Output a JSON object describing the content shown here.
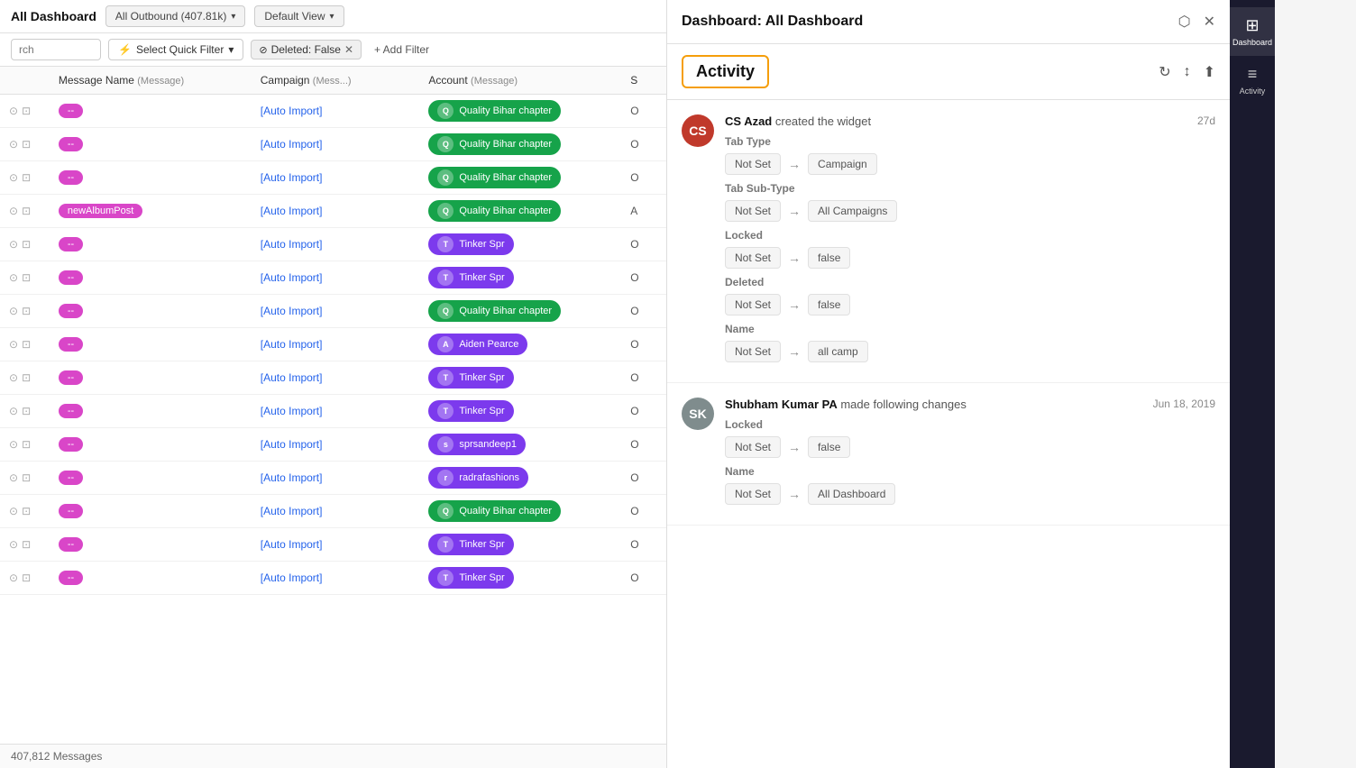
{
  "topBar": {
    "title": "All Dashboard",
    "filterLabel": "All Outbound (407.81k)",
    "viewLabel": "Default View"
  },
  "filterBar": {
    "searchPlaceholder": "rch",
    "quickFilterLabel": "Select Quick Filter",
    "deletedFilterLabel": "Deleted: False",
    "addFilterLabel": "+ Add Filter"
  },
  "table": {
    "columns": [
      {
        "name": "Message Name",
        "type": "Message"
      },
      {
        "name": "Campaign",
        "type": "Mess..."
      },
      {
        "name": "Account",
        "type": "Message"
      },
      {
        "name": "S",
        "type": ""
      }
    ],
    "rows": [
      {
        "tag": "--",
        "tagColor": "pink",
        "campaign": "[Auto Import]",
        "account": "Quality Bihar chapter",
        "accountColor": "green",
        "status": "O"
      },
      {
        "tag": "--",
        "tagColor": "pink",
        "campaign": "[Auto Import]",
        "account": "Quality Bihar chapter",
        "accountColor": "green",
        "status": "O"
      },
      {
        "tag": "--",
        "tagColor": "pink",
        "campaign": "[Auto Import]",
        "account": "Quality Bihar chapter",
        "accountColor": "green",
        "status": "O"
      },
      {
        "tag": "newAlbumPost",
        "tagColor": "pink",
        "campaign": "[Auto Import]",
        "account": "Quality Bihar chapter",
        "accountColor": "green",
        "status": "A"
      },
      {
        "tag": "--",
        "tagColor": "pink",
        "campaign": "[Auto Import]",
        "account": "Tinker Spr",
        "accountColor": "purple",
        "status": "O"
      },
      {
        "tag": "--",
        "tagColor": "pink",
        "campaign": "[Auto Import]",
        "account": "Tinker Spr",
        "accountColor": "purple",
        "status": "O"
      },
      {
        "tag": "--",
        "tagColor": "pink",
        "campaign": "[Auto Import]",
        "account": "Quality Bihar chapter",
        "accountColor": "green",
        "status": "O"
      },
      {
        "tag": "--",
        "tagColor": "pink",
        "campaign": "[Auto Import]",
        "account": "Aiden Pearce",
        "accountColor": "purple",
        "status": "O"
      },
      {
        "tag": "--",
        "tagColor": "pink",
        "campaign": "[Auto Import]",
        "account": "Tinker Spr",
        "accountColor": "purple",
        "status": "O"
      },
      {
        "tag": "--",
        "tagColor": "pink",
        "campaign": "[Auto Import]",
        "account": "Tinker Spr",
        "accountColor": "purple",
        "status": "O"
      },
      {
        "tag": "--",
        "tagColor": "pink",
        "campaign": "[Auto Import]",
        "account": "sprsandeep1",
        "accountColor": "purple",
        "status": "O"
      },
      {
        "tag": "--",
        "tagColor": "pink",
        "campaign": "[Auto Import]",
        "account": "radrafashions",
        "accountColor": "purple",
        "status": "O"
      },
      {
        "tag": "--",
        "tagColor": "pink",
        "campaign": "[Auto Import]",
        "account": "Quality Bihar chapter",
        "accountColor": "green",
        "status": "O"
      },
      {
        "tag": "--",
        "tagColor": "pink",
        "campaign": "[Auto Import]",
        "account": "Tinker Spr",
        "accountColor": "purple",
        "status": "O"
      },
      {
        "tag": "--",
        "tagColor": "pink",
        "campaign": "[Auto Import]",
        "account": "Tinker Spr",
        "accountColor": "purple",
        "status": "O"
      }
    ],
    "footerCount": "407,812 Messages"
  },
  "panel": {
    "title": "Dashboard: All Dashboard",
    "activityTabLabel": "Activity",
    "activities": [
      {
        "user": "CS Azad",
        "action": "created the widget",
        "time": "27d",
        "avatarColor": "#c0392b",
        "avatarInitials": "CS",
        "changes": [
          {
            "sectionLabel": "Tab Type",
            "from": "Not Set",
            "to": "Campaign"
          },
          {
            "sectionLabel": "Tab Sub-Type",
            "from": "Not Set",
            "to": "All Campaigns"
          },
          {
            "sectionLabel": "Locked",
            "from": "Not Set",
            "to": "false"
          },
          {
            "sectionLabel": "Deleted",
            "from": "Not Set",
            "to": "false"
          },
          {
            "sectionLabel": "Name",
            "from": "Not Set",
            "to": "all camp"
          }
        ]
      },
      {
        "user": "Shubham Kumar PA",
        "action": "made following changes",
        "time": "Jun 18, 2019",
        "avatarColor": "#7f8c8d",
        "avatarInitials": "SK",
        "changes": [
          {
            "sectionLabel": "Locked",
            "from": "Not Set",
            "to": "false"
          },
          {
            "sectionLabel": "Name",
            "from": "Not Set",
            "to": "All Dashboard"
          }
        ]
      }
    ]
  },
  "sidebar": {
    "items": [
      {
        "label": "Dashboard",
        "icon": "⊞",
        "active": true
      },
      {
        "label": "Activity",
        "icon": "≡",
        "active": false
      }
    ]
  }
}
